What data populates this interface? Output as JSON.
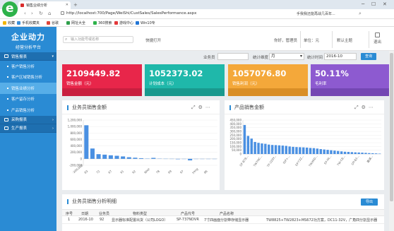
{
  "browser": {
    "tab_title": "销售业绩分析",
    "url": "http://localhost:700/Page/WeiShi/CustSales/SalesPerformance.aspx",
    "right_text": "手我我还能再战几百年...",
    "bookmarks": [
      "收藏",
      "手机收藏夹",
      "谷歌",
      "网址大全",
      "360搜索",
      "游戏中心",
      "Win10专"
    ]
  },
  "sidebar": {
    "brand_title": "企业动力",
    "brand_sub": "经营分析平台",
    "groups": [
      {
        "label": "销售报表",
        "items": [
          "客户销售分析",
          "客户区域销售分析",
          "销售业绩分析",
          "客户留存分析",
          "产品销售分析"
        ]
      },
      {
        "label": "采购报表"
      },
      {
        "label": "生产报表"
      }
    ]
  },
  "header": {
    "search_placeholder": "输入功能号或名称",
    "quick_open": "快捷打开",
    "greeting": "你好，管理员",
    "unit": "单位：元",
    "default_theme": "默认主题",
    "exit": "退出"
  },
  "filter": {
    "salesman_label": "业务员",
    "salesman_value": "",
    "period_label": "统计维度",
    "period_value": "月",
    "time_label": "统计时间",
    "time_value": "2016-10",
    "query": "查询"
  },
  "kpis": [
    {
      "value": "2109449.82",
      "label": "销售金额（元）",
      "color": "#e8264a",
      "foot": "#c81f3f"
    },
    {
      "value": "1052373.02",
      "label": "计划成本（元）",
      "color": "#1fb8aa",
      "foot": "#19998e"
    },
    {
      "value": "1057076.80",
      "label": "销售利润（元）",
      "color": "#f4a83a",
      "foot": "#d98e26"
    },
    {
      "value": "50.11%",
      "label": "毛利率",
      "color": "#8d5ad0",
      "foot": "#7447b3"
    }
  ],
  "panels": {
    "salesman_title": "业务员销售金额",
    "product_title": "产品销售金额",
    "detail_title": "业务员销售分析明细",
    "export": "导出"
  },
  "chart_data": [
    {
      "type": "bar",
      "title": "业务员销售金额",
      "yticks": [
        "1,200,000",
        "1,000,000",
        "800,000",
        "600,000",
        "400,000",
        "200,000",
        "0",
        "-200,000"
      ],
      "ylim": [
        -200000,
        1200000
      ],
      "categories": [
        "83",
        "72",
        "67",
        "91",
        "92",
        "WXP",
        "78",
        "69",
        "97",
        "yang",
        "86"
      ],
      "xtick_labels": [
        "-200,000",
        "83",
        "72",
        "67",
        "91",
        "92",
        "WXP",
        "78",
        "69",
        "97",
        "yang",
        "86"
      ],
      "values": [
        1040000,
        320000,
        145000,
        130000,
        110000,
        95000,
        75000,
        50000,
        35000,
        20000,
        8000,
        30000,
        6000,
        2000,
        1000,
        -12000,
        -3000,
        -48000,
        0,
        0,
        0,
        0
      ]
    },
    {
      "type": "bar",
      "title": "产品销售金额",
      "yticks": [
        "450,000",
        "400,000",
        "350,000",
        "300,000",
        "250,000",
        "200,000",
        "150,000",
        "100,000",
        "50,000",
        "0"
      ],
      "ylim": [
        0,
        450000
      ],
      "categories": [
        "DF-BT8...",
        "TW7NC...",
        "TP-320Y...",
        "IDP+...",
        "EP-T3Z...",
        "TWXKD...",
        "EP-FA...",
        "TW-CB...",
        "DP-B3...",
        "嘉诚..."
      ],
      "values": [
        385000,
        240000,
        205000,
        160000,
        148000,
        140000,
        135000,
        125000,
        120000,
        118000,
        115000,
        112000,
        108000,
        100000,
        95000,
        92000,
        90000,
        88000,
        85000,
        80000,
        78000,
        72000,
        65000,
        60000,
        55000,
        50000,
        45000,
        40000,
        35000,
        30000,
        28000,
        25000,
        22000,
        20000,
        18000,
        15000,
        12000,
        10000,
        8000,
        5000
      ]
    }
  ],
  "table": {
    "headers": [
      "序号",
      "日期",
      "业务员",
      "物料类型",
      "产品代号",
      "产品名称"
    ],
    "rows": [
      [
        "1",
        "2016-10",
        "92",
        "显示器标准配置出货（公司LOGO）",
        "SP-737NDVR",
        "7寸四画面分割带存储显示器",
        "TW8825+TW2823+MS672功方案，DC11-32V，广角四分割显示器"
      ]
    ]
  }
}
